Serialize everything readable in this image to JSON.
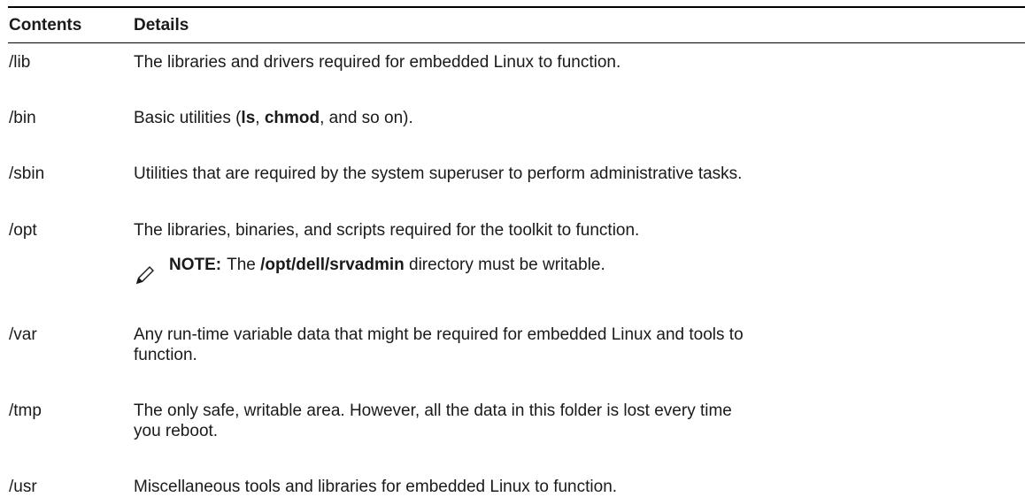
{
  "table": {
    "headers": {
      "contents": "Contents",
      "details": "Details"
    },
    "rows": [
      {
        "dir": "/lib",
        "details": "The libraries and drivers required for embedded Linux to function."
      },
      {
        "dir": "/bin",
        "details_pre": "Basic utilities (",
        "bold1": "ls",
        "sep": ", ",
        "bold2": "chmod",
        "details_post": ", and so on)."
      },
      {
        "dir": "/sbin",
        "details": "Utilities that are required by the system superuser to perform administrative tasks."
      },
      {
        "dir": "/opt",
        "details": "The libraries, binaries, and scripts required for the toolkit to function.",
        "note": {
          "label": "NOTE:",
          "pre": "The ",
          "path": "/opt/dell/srvadmin",
          "post": " directory must be writable.",
          "icon": "pencil-note-icon"
        }
      },
      {
        "dir": "/var",
        "details": "Any run-time variable data that might be required for embedded Linux and tools to function."
      },
      {
        "dir": "/tmp",
        "details": "The only safe, writable area. However, all the data in this folder is lost every time you reboot."
      },
      {
        "dir": "/usr",
        "details": "Miscellaneous tools and libraries for embedded Linux to function."
      }
    ]
  }
}
